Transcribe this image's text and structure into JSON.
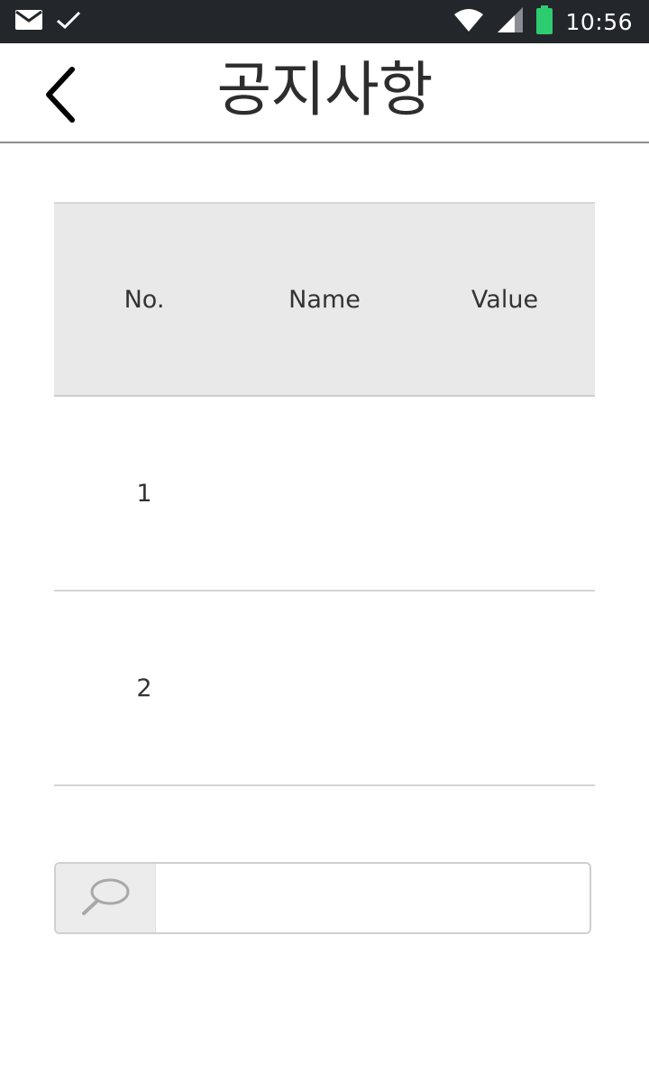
{
  "status_bar": {
    "time": "10:56",
    "left_icons": [
      "mail-icon",
      "check-icon"
    ],
    "right_icons": [
      "wifi-icon",
      "signal-icon",
      "battery-icon"
    ],
    "battery_color": "#2ecc71"
  },
  "header": {
    "title": "공지사항",
    "back_icon": "chevron-left-icon"
  },
  "table": {
    "columns": [
      "No.",
      "Name",
      "Value"
    ],
    "rows": [
      {
        "no": "1",
        "name": "",
        "value": ""
      },
      {
        "no": "2",
        "name": "",
        "value": ""
      }
    ]
  },
  "search": {
    "icon": "search-icon",
    "value": "",
    "placeholder": ""
  }
}
